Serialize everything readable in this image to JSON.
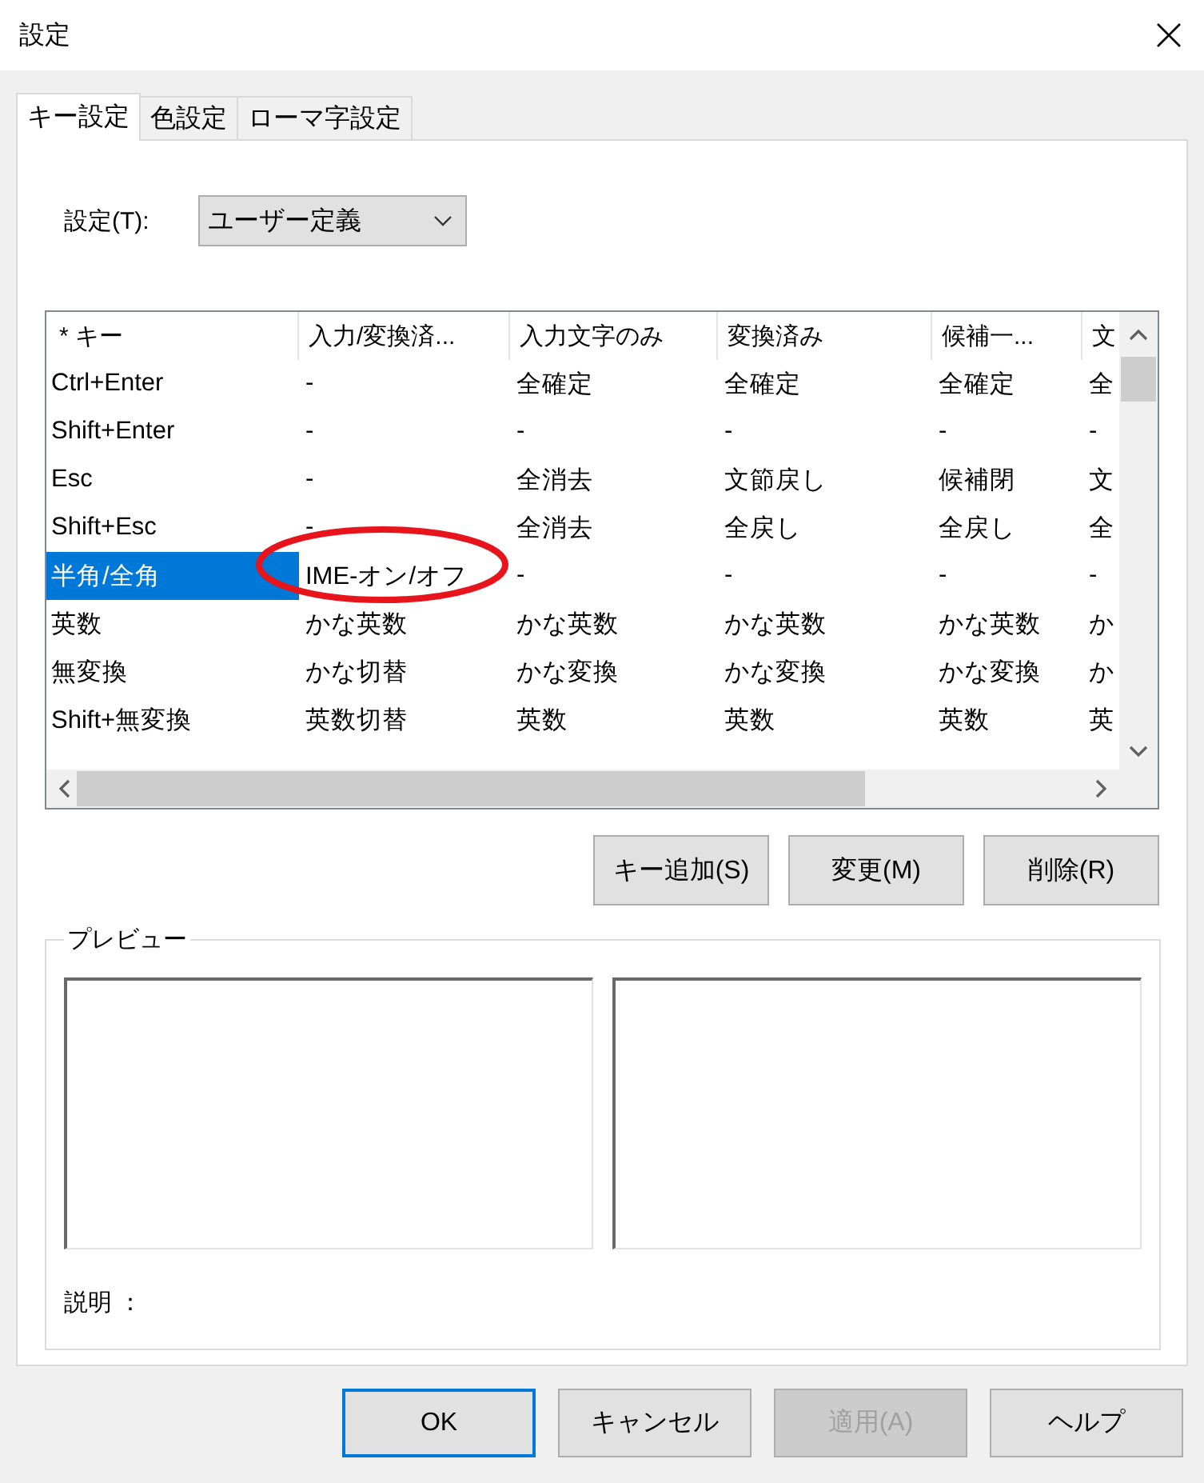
{
  "window": {
    "title": "設定"
  },
  "tabs": [
    {
      "label": "キー設定",
      "selected": true
    },
    {
      "label": "色設定",
      "selected": false
    },
    {
      "label": "ローマ字設定",
      "selected": false
    }
  ],
  "setting": {
    "label": "設定(T):",
    "value": "ユーザー定義"
  },
  "table": {
    "columns": [
      "* キー",
      "入力/変換済...",
      "入力文字のみ",
      "変換済み",
      "候補一...",
      "文"
    ],
    "rows": [
      {
        "cells": [
          "Ctrl+Enter",
          "-",
          "全確定",
          "全確定",
          "全確定",
          "全"
        ],
        "selected": false
      },
      {
        "cells": [
          "Shift+Enter",
          "-",
          "-",
          "-",
          "-",
          "-"
        ],
        "selected": false
      },
      {
        "cells": [
          "Esc",
          "-",
          "全消去",
          "文節戻し",
          "候補閉",
          "文"
        ],
        "selected": false
      },
      {
        "cells": [
          "Shift+Esc",
          "-",
          "全消去",
          "全戻し",
          "全戻し",
          "全"
        ],
        "selected": false
      },
      {
        "cells": [
          "半角/全角",
          "IME-オン/オフ",
          "-",
          "-",
          "-",
          "-"
        ],
        "selected": true
      },
      {
        "cells": [
          "英数",
          "かな英数",
          "かな英数",
          "かな英数",
          "かな英数",
          "か"
        ],
        "selected": false
      },
      {
        "cells": [
          "無変換",
          "かな切替",
          "かな変換",
          "かな変換",
          "かな変換",
          "か"
        ],
        "selected": false
      },
      {
        "cells": [
          "Shift+無変換",
          "英数切替",
          "英数",
          "英数",
          "英数",
          "英"
        ],
        "selected": false
      }
    ]
  },
  "key_buttons": [
    {
      "label": "キー追加(S)"
    },
    {
      "label": "変更(M)"
    },
    {
      "label": "削除(R)"
    }
  ],
  "preview": {
    "title": "プレビュー",
    "description_label": "説明 ："
  },
  "buttons": [
    {
      "label": "OK",
      "default": true,
      "disabled": false
    },
    {
      "label": "キャンセル",
      "default": false,
      "disabled": false
    },
    {
      "label": "適用(A)",
      "default": false,
      "disabled": true
    },
    {
      "label": "ヘルプ",
      "default": false,
      "disabled": false
    }
  ]
}
